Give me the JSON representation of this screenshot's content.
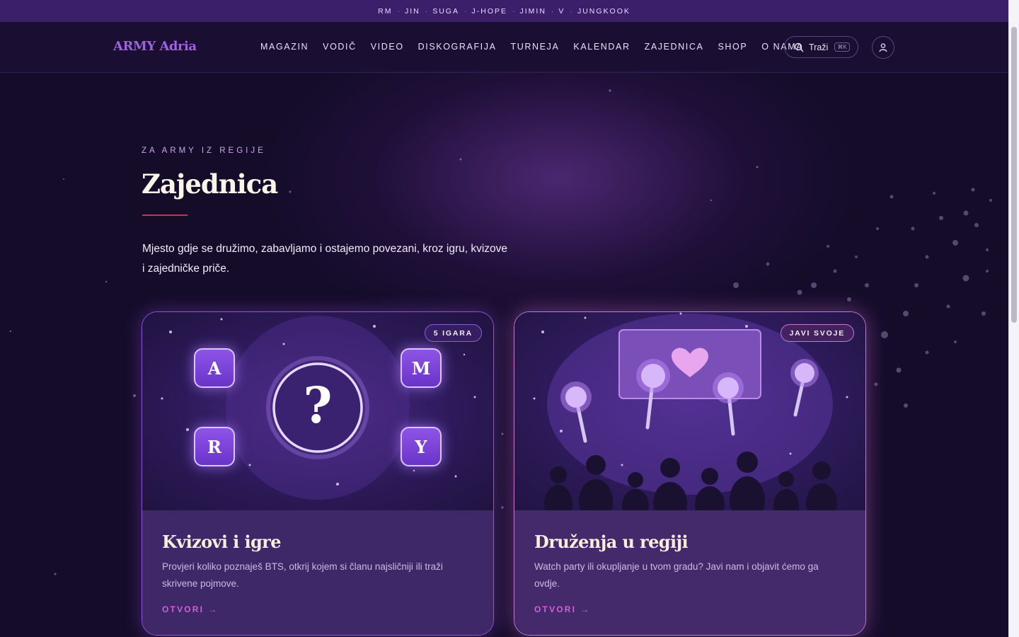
{
  "topbar": {
    "members": [
      "RM",
      "JIN",
      "SUGA",
      "J-HOPE",
      "JIMIN",
      "V",
      "JUNGKOOK"
    ]
  },
  "nav": {
    "logo": "ARMY Adria",
    "links": [
      "MAGAZIN",
      "VODIČ",
      "VIDEO",
      "DISKOGRAFIJA",
      "TURNEJA",
      "KALENDAR",
      "ZAJEDNICA",
      "SHOP",
      "O NAMA"
    ],
    "search_label": "Traži",
    "search_shortcut": "⌘K"
  },
  "hero": {
    "eyebrow": "ZA ARMY IZ REGIJE",
    "title": "Zajednica",
    "lead": "Mjesto gdje se družimo, zabavljamo i ostajemo povezani, kroz igru, kvizove i zajedničke priče."
  },
  "cards": [
    {
      "badge": "5 IGARA",
      "title": "Kvizovi i igre",
      "description": "Provjeri koliko poznaješ BTS, otkrij kojem si članu najsličniji ili traži skrivene pojmove.",
      "link": "OTVORI",
      "tiles": [
        "A",
        "M",
        "R",
        "Y"
      ],
      "center_glyph": "?"
    },
    {
      "badge": "JAVI SVOJE",
      "title": "Druženja u regiji",
      "description": "Watch party ili okupljanje u tvom gradu? Javi nam i objavit ćemo ga ovdje.",
      "link": "OTVORI"
    }
  ],
  "colors": {
    "background": "#150c2a",
    "topbar": "#3b1f6b",
    "accent": "#a25fe0",
    "link": "#d15fd6",
    "rule": "#c2365a"
  }
}
